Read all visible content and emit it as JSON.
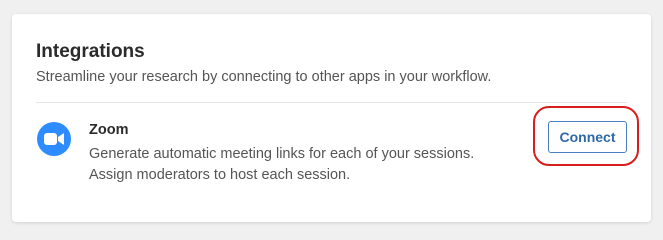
{
  "integrations": {
    "title": "Integrations",
    "subtitle": "Streamline your research by connecting to other apps in your workflow."
  },
  "zoom": {
    "icon": "zoom-camera-icon",
    "name": "Zoom",
    "description": "Generate automatic meeting links for each of your sessions. Assign moderators to host each session.",
    "connect_label": "Connect"
  },
  "colors": {
    "zoom_brand": "#2d8cff",
    "button_accent": "#2f6aa8",
    "annotation_ring": "#d81d1d"
  }
}
